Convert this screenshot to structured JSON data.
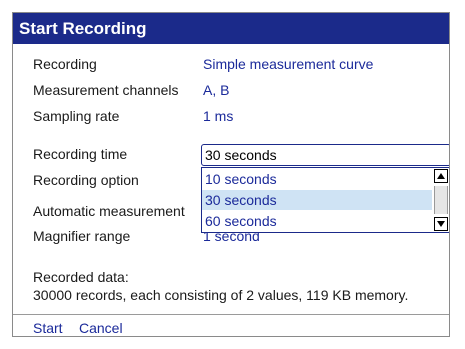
{
  "dialog": {
    "title": "Start Recording"
  },
  "rows": [
    {
      "label": "Recording",
      "value": "Simple measurement curve"
    },
    {
      "label": "Measurement channels",
      "value": "A, B"
    },
    {
      "label": "Sampling rate",
      "value": "1 ms"
    },
    {
      "label": "Recording time"
    },
    {
      "label": "Recording option"
    },
    {
      "label": "Automatic measurement"
    },
    {
      "label": "Magnifier range",
      "value": "1 second"
    }
  ],
  "recording_time": {
    "selected": "30 seconds",
    "options": [
      "10 seconds",
      "30 seconds",
      "60 seconds"
    ],
    "highlighted_option": "30 seconds"
  },
  "info": {
    "heading": "Recorded data:",
    "text": "30000 records, each consisting of 2 values, 119 KB memory."
  },
  "softkeys": {
    "start": "Start",
    "cancel": "Cancel"
  },
  "colors": {
    "titlebar": "#1b2a8a",
    "value_text": "#1b2a9a",
    "highlight": "#cfe3f4"
  },
  "icons": {
    "scroll_up": "scroll-up-arrow-icon",
    "scroll_down": "scroll-down-arrow-icon"
  }
}
